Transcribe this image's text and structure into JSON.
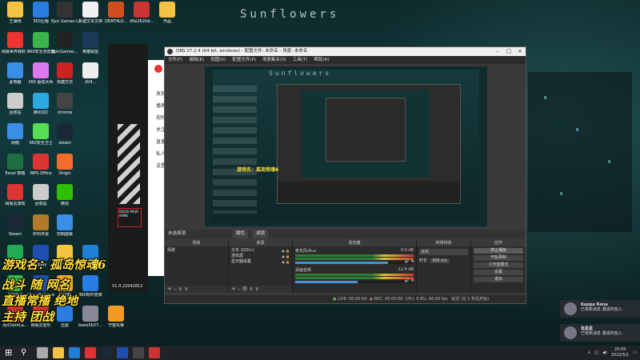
{
  "wallpaper": {
    "title": "Sunflowers"
  },
  "desktop_icons": [
    {
      "label": "王海明",
      "color": "#f5c243",
      "icon": "folder-icon"
    },
    {
      "label": "360压缩",
      "color": "#2a7de1",
      "icon": "archive-icon"
    },
    {
      "label": "Epic Games Launcher",
      "color": "#333",
      "icon": "epic-icon"
    },
    {
      "label": "新建文本文档",
      "color": "#f0f0f0",
      "icon": "text-file-icon"
    },
    {
      "label": "DEATHLO...",
      "color": "#d04e1e",
      "icon": "game-icon"
    },
    {
      "label": "d5e2620d...",
      "color": "#c33",
      "icon": "image-icon"
    },
    {
      "label": "作品",
      "color": "#f5c243",
      "icon": "folder-icon"
    },
    {
      "label": "网易世界我的 平台",
      "color": "#e33",
      "icon": "app-icon"
    },
    {
      "label": "360安全浏览器",
      "color": "#39b54a",
      "icon": "browser-icon"
    },
    {
      "label": "EpicGames...",
      "color": "#222",
      "icon": "epic-icon"
    },
    {
      "label": "英雄联盟",
      "color": "#1b3a5a",
      "icon": "game-icon"
    },
    {
      "label": "此电脑",
      "color": "#3a8ee6",
      "icon": "computer-icon"
    },
    {
      "label": "360 驱动大师",
      "color": "#d7e",
      "icon": "driver-icon"
    },
    {
      "label": "快捷方式",
      "color": "#c22",
      "icon": "shortcut-icon"
    },
    {
      "label": "204...",
      "color": "#eee",
      "icon": "game-icon"
    },
    {
      "label": "回收站",
      "color": "#ccc",
      "icon": "recycle-bin-icon"
    },
    {
      "label": "腾讯QQ",
      "color": "#2aa9e0",
      "icon": "qq-icon"
    },
    {
      "label": "chrome",
      "color": "#444",
      "icon": "chrome-icon"
    },
    {
      "label": "网络",
      "color": "#3a8ee6",
      "icon": "network-icon"
    },
    {
      "label": "360安全卫士",
      "color": "#5d5",
      "icon": "security-icon"
    },
    {
      "label": "steam",
      "color": "#1b2838",
      "icon": "steam-icon"
    },
    {
      "label": "Excel 表格",
      "color": "#1d6f42",
      "icon": "excel-icon"
    },
    {
      "label": "WPS Office",
      "color": "#d33",
      "icon": "wps-icon"
    },
    {
      "label": "Origin",
      "color": "#f56c2d",
      "icon": "origin-icon"
    },
    {
      "label": "网易云游戏",
      "color": "#d33",
      "icon": "cloud-game-icon"
    },
    {
      "label": "回收站",
      "color": "#ccc",
      "icon": "recycle-bin-icon"
    },
    {
      "label": "微信",
      "color": "#2dc100",
      "icon": "wechat-icon"
    },
    {
      "label": "Steam",
      "color": "#1b2838",
      "icon": "steam-icon"
    },
    {
      "label": "炉石传说",
      "color": "#b07a2a",
      "icon": "game-icon"
    },
    {
      "label": "控制面板",
      "color": "#3a8ee6",
      "icon": "control-panel-icon"
    },
    {
      "label": "Bandicut",
      "color": "#2a5",
      "icon": "video-icon"
    },
    {
      "label": "Uplay",
      "color": "#1e4fb0",
      "icon": "uplay-icon"
    },
    {
      "label": "YY语音",
      "color": "#f5c243",
      "icon": "yy-icon"
    },
    {
      "label": "Microsoft Edge",
      "color": "#1e7fd6",
      "icon": "edge-icon"
    },
    {
      "label": "360杀毒",
      "color": "#39b54a",
      "icon": "antivirus-icon"
    },
    {
      "label": "Ubisoft Connect",
      "color": "#1e4fb0",
      "icon": "ubisoft-icon"
    },
    {
      "label": "向日葵",
      "color": "#f5a623",
      "icon": "sunflower-icon"
    },
    {
      "label": "360软件管家",
      "color": "#2a7de1",
      "icon": "software-icon"
    },
    {
      "label": "dyClientLa...",
      "color": "#c33",
      "icon": "app-icon"
    },
    {
      "label": "网易云音乐",
      "color": "#d33",
      "icon": "music-icon"
    },
    {
      "label": "迅雷",
      "color": "#2a7de1",
      "icon": "xunlei-icon"
    },
    {
      "label": "beee5b37...",
      "color": "#889",
      "icon": "image-icon"
    },
    {
      "label": "守望先锋",
      "color": "#f29a20",
      "icon": "overwatch-icon"
    }
  ],
  "overlay": {
    "line1": "游戏名：孤岛惊魂6",
    "line2": "战斗 随 网名",
    "line3": "直播常播 绝地",
    "line4": "主持 团战"
  },
  "back_app": {
    "items": [
      "发现",
      "播客",
      "视频",
      "关注",
      "直播",
      "私人",
      "设置"
    ],
    "version": "V1.0.22042812",
    "badge": "REGIS MAJO RANK"
  },
  "obs": {
    "title": "OBS 27.2.4 (64-bit, windows) - 配置文件: 未命名 - 场景: 未命名",
    "menu": [
      "文件(F)",
      "编辑(E)",
      "视图(V)",
      "配置文件(P)",
      "场景集合(S)",
      "工具(T)",
      "帮助(H)"
    ],
    "toolbar": {
      "no_source": "未选择源",
      "properties": "属性",
      "filters": "滤镜"
    },
    "docks": {
      "scenes": {
        "title": "场景",
        "items": [
          "场景"
        ]
      },
      "sources": {
        "title": "来源",
        "items": [
          "文本 (GDI+)",
          "游戏源",
          "显示器采集"
        ]
      },
      "mixer": {
        "title": "混音器",
        "channels": [
          {
            "name": "麦克风/Aux",
            "db": "0.0 dB",
            "level": 0.92
          },
          {
            "name": "桌面音频",
            "db": "-12.4 dB",
            "level": 0.62
          }
        ]
      },
      "transitions": {
        "title": "转场特效",
        "type": "淡出",
        "duration_label": "时长",
        "duration": "300 ms"
      },
      "controls": {
        "title": "控件",
        "buttons": [
          "停止播放",
          "开始录制",
          "工作室模式",
          "设置",
          "退出"
        ]
      }
    },
    "status": {
      "live": "LIVE: 00:00:00",
      "rec": "REC: 00:00:00",
      "cpu": "CPU: 0.9%, 60.00 fps",
      "drop": "延迟 (在 1 秒后开始)"
    }
  },
  "notifications": [
    {
      "name": "Kappa Rena",
      "text": "已有新消息 邀请你加入"
    },
    {
      "name": "鱼星星",
      "text": "已有新消息 邀请你加入"
    }
  ],
  "taskbar": {
    "icons": [
      "windows-icon",
      "search-icon",
      "task-view-icon",
      "file-explorer-icon",
      "edge-icon",
      "netease-music-icon",
      "steam-icon",
      "ubisoft-icon",
      "obs-icon",
      "netease-icon"
    ],
    "time": "20:04",
    "date": "2022/5/1"
  }
}
